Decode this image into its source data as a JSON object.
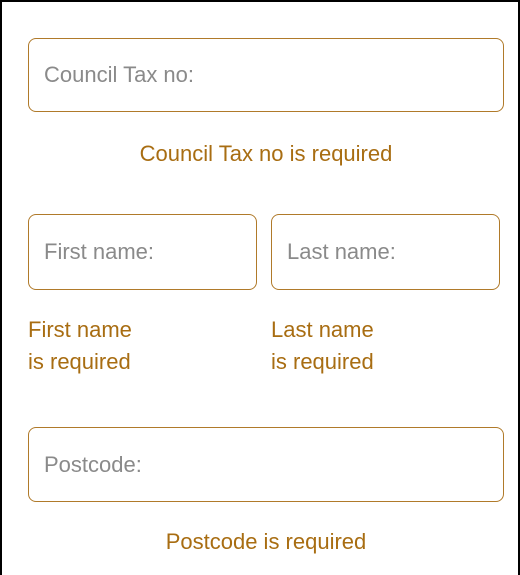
{
  "form": {
    "council_tax": {
      "placeholder": "Council Tax no:",
      "value": "",
      "error": "Council Tax no is required"
    },
    "first_name": {
      "placeholder": "First name:",
      "value": "",
      "error_line1": "First name",
      "error_line2": "is required"
    },
    "last_name": {
      "placeholder": "Last name:",
      "value": "",
      "error_line1": "Last name",
      "error_line2": "is required"
    },
    "postcode": {
      "placeholder": "Postcode:",
      "value": "",
      "error": "Postcode is required"
    }
  },
  "colors": {
    "accent": "#b07a2a",
    "error_text": "#a86d12",
    "placeholder": "#8a8a8a"
  }
}
